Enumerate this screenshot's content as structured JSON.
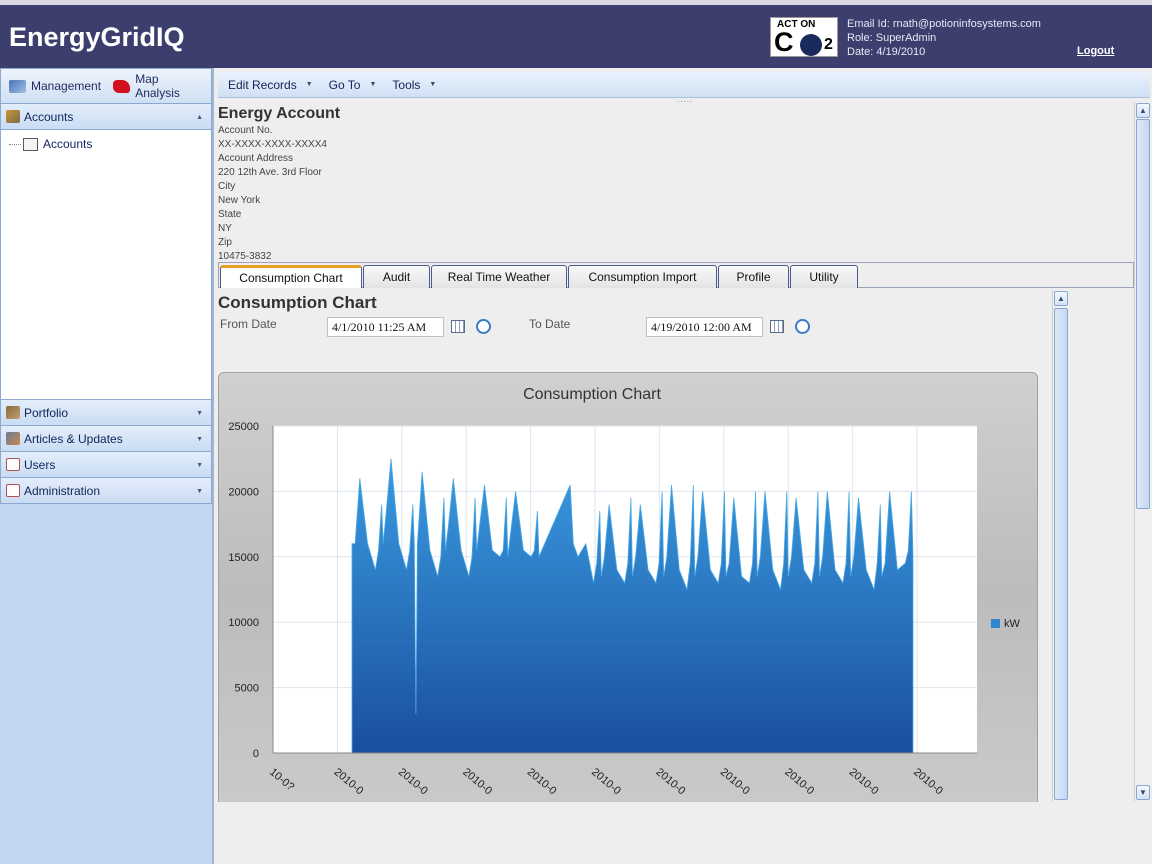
{
  "header": {
    "app_title": "EnergyGridIQ",
    "logo_text_top": "ACT ON",
    "logo_text_main": "C",
    "logo_text_sub": "2",
    "email": "Email Id: rnath@potioninfosystems.com",
    "role": "Role: SuperAdmin",
    "date": "Date: 4/19/2010",
    "logout": "Logout"
  },
  "nav": {
    "management": "Management",
    "map_analysis": "Map Analysis",
    "accounts_header": "Accounts",
    "accounts_item": "Accounts",
    "portfolio": "Portfolio",
    "articles": "Articles & Updates",
    "users": "Users",
    "administration": "Administration"
  },
  "toolbar": {
    "edit_records": "Edit Records",
    "go_to": "Go To",
    "tools": "Tools",
    "grip": "....."
  },
  "account": {
    "title": "Energy Account",
    "account_no_label": "Account No.",
    "account_no": "XX-XXXX-XXXX-XXXX4",
    "address_label": "Account Address",
    "address": "220 12th Ave. 3rd Floor",
    "city_label": "City",
    "city": "New York",
    "state_label": "State",
    "state": "NY",
    "zip_label": "Zip",
    "zip": "10475-3832"
  },
  "tabs": [
    "Consumption Chart",
    "Audit",
    "Real Time Weather",
    "Consumption Import",
    "Profile",
    "Utility"
  ],
  "consumption": {
    "heading": "Consumption Chart",
    "from_label": "From Date",
    "from_value": "4/1/2010 11:25 AM",
    "to_label": "To Date",
    "to_value": "4/19/2010 12:00 AM"
  },
  "chart_data": {
    "type": "area",
    "title": "Consumption Chart",
    "xlabel": "",
    "ylabel": "",
    "ylim": [
      0,
      25000
    ],
    "yticks": [
      0,
      5000,
      10000,
      15000,
      20000,
      25000
    ],
    "xtick_labels": [
      "10-0?",
      "2010-0",
      "2010-0",
      "2010-0",
      "2010-0",
      "2010-0",
      "2010-0",
      "2010-0",
      "2010-0",
      "2010-0",
      "2010-0"
    ],
    "legend": "right",
    "grid": true,
    "series": [
      {
        "name": "kW",
        "color": "#2f86cf",
        "x": [
          0.0,
          0.1,
          0.25,
          0.5,
          0.75,
          0.85,
          0.95,
          1.0,
          1.1,
          1.25,
          1.5,
          1.75,
          1.85,
          1.95,
          2.0,
          2.05,
          2.1,
          2.25,
          2.5,
          2.75,
          2.85,
          2.95,
          3.0,
          3.1,
          3.25,
          3.5,
          3.75,
          3.85,
          3.95,
          4.0,
          4.1,
          4.25,
          4.5,
          4.75,
          4.85,
          4.95,
          5.0,
          5.1,
          5.25,
          5.5,
          5.75,
          5.85,
          5.95,
          6.0,
          7.0,
          7.1,
          7.25,
          7.5,
          7.75,
          7.85,
          7.95,
          8.0,
          8.1,
          8.25,
          8.5,
          8.75,
          8.85,
          8.95,
          9.0,
          9.1,
          9.25,
          9.5,
          9.75,
          9.85,
          9.95,
          10.0,
          10.1,
          10.25,
          10.5,
          10.75,
          10.85,
          10.95,
          11.0,
          11.1,
          11.25,
          11.5,
          11.75,
          11.85,
          11.95,
          12.0,
          12.1,
          12.25,
          12.5,
          12.75,
          12.85,
          12.95,
          13.0,
          13.1,
          13.25,
          13.5,
          13.75,
          13.85,
          13.95,
          14.0,
          14.1,
          14.25,
          14.5,
          14.75,
          14.85,
          14.95,
          15.0,
          15.1,
          15.25,
          15.5,
          15.75,
          15.85,
          15.95,
          16.0,
          16.1,
          16.25,
          16.5,
          16.75,
          16.85,
          16.95,
          17.0,
          17.1,
          17.25,
          17.5,
          17.75,
          17.85,
          17.95,
          18.0
        ],
        "values": [
          16000,
          16000,
          21000,
          16000,
          14000,
          15500,
          19000,
          16000,
          18500,
          22500,
          16000,
          14000,
          15500,
          19000,
          16000,
          3000,
          16000,
          21500,
          15500,
          13500,
          15000,
          19500,
          15500,
          17500,
          21000,
          15500,
          13500,
          15000,
          19500,
          15500,
          17500,
          20500,
          15500,
          15000,
          15500,
          19500,
          15000,
          17000,
          20000,
          15500,
          15000,
          15500,
          18500,
          15000,
          20500,
          16000,
          15000,
          16000,
          13000,
          14500,
          18500,
          13500,
          15000,
          19000,
          14000,
          13000,
          14500,
          19500,
          13500,
          15000,
          19000,
          14000,
          13000,
          14500,
          20000,
          13500,
          15000,
          20500,
          14000,
          12500,
          14500,
          20500,
          13500,
          15000,
          20000,
          14000,
          13000,
          14500,
          20000,
          13500,
          14500,
          19500,
          13500,
          13000,
          14500,
          20000,
          13500,
          15000,
          20000,
          14000,
          12500,
          14500,
          20000,
          13500,
          15000,
          19500,
          14000,
          13000,
          14500,
          20000,
          13500,
          15000,
          20000,
          14000,
          13000,
          14500,
          20000,
          13500,
          15000,
          19500,
          14000,
          12500,
          14500,
          19000,
          13500,
          14500,
          20000,
          14000,
          14500,
          15500,
          20000,
          15000
        ]
      }
    ]
  }
}
